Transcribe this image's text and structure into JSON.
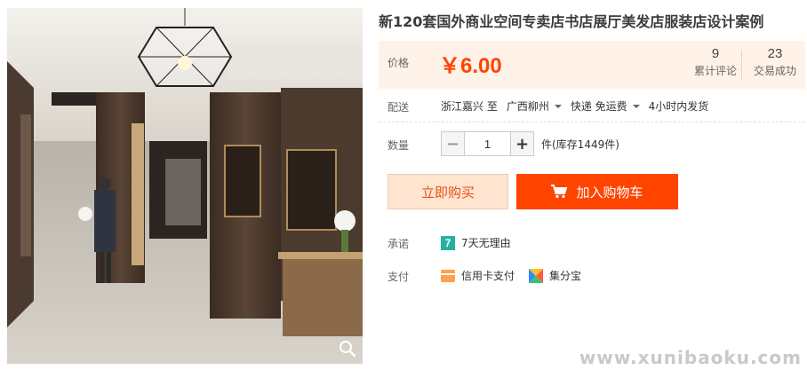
{
  "product": {
    "title": "新120套国外商业空间专卖店书店展厅美发店服装店设计案例",
    "image_alt": "menswear boutique interior"
  },
  "price": {
    "label": "价格",
    "value": "￥6.00"
  },
  "stats": {
    "reviews_count": "9",
    "reviews_label": "累计评论",
    "sales_count": "23",
    "sales_label": "交易成功"
  },
  "shipping": {
    "label": "配送",
    "from": "浙江嘉兴 至",
    "to": "广西柳州",
    "method": "快递 免运费",
    "dispatch": "4小时内发货"
  },
  "quantity": {
    "label": "数量",
    "minus": "−",
    "value": "1",
    "plus": "+",
    "stock": "件(库存1449件)"
  },
  "buttons": {
    "buy_now": "立即购买",
    "add_to_cart": "加入购物车"
  },
  "promise": {
    "label": "承诺",
    "badge": "7",
    "text": "7天无理由"
  },
  "payment": {
    "label": "支付",
    "options": [
      "信用卡支付",
      "集分宝"
    ]
  },
  "watermark": "www.xunibaoku.com",
  "colors": {
    "accent": "#ff4400",
    "price_panel_bg": "#fff2e8",
    "buy_now_bg": "#ffe4d0",
    "promise_badge": "#22b3a0"
  }
}
